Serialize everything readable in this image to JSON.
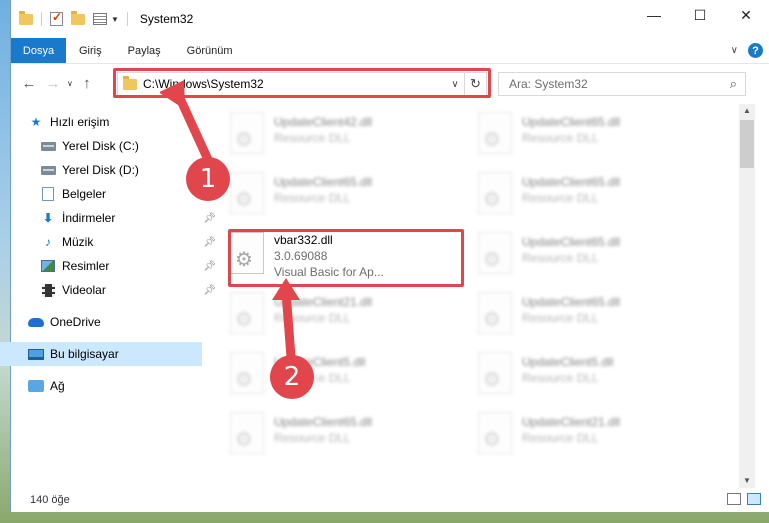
{
  "window": {
    "title": "System32",
    "controls": {
      "minimize": "—",
      "maximize": "☐",
      "close": "✕"
    }
  },
  "ribbon": {
    "tabs": [
      "Dosya",
      "Giriş",
      "Paylaş",
      "Görünüm"
    ],
    "help": "?",
    "expand": "∨"
  },
  "address": {
    "path": "C:\\Windows\\System32",
    "search_placeholder": "Ara: System32"
  },
  "nav_glyphs": {
    "back": "←",
    "forward": "→",
    "up": "↑",
    "refresh": "↻",
    "dropdown": "∨",
    "search": "⌕"
  },
  "sidebar": {
    "quick_access": "Hızlı erişim",
    "items": [
      {
        "label": "Yerel Disk (C:)",
        "icon": "drive-icon",
        "pinned": false
      },
      {
        "label": "Yerel Disk (D:)",
        "icon": "drive-icon",
        "pinned": false
      },
      {
        "label": "Belgeler",
        "icon": "documents-icon",
        "pinned": true
      },
      {
        "label": "İndirmeler",
        "icon": "downloads-icon",
        "pinned": true
      },
      {
        "label": "Müzik",
        "icon": "music-icon",
        "pinned": true
      },
      {
        "label": "Resimler",
        "icon": "pictures-icon",
        "pinned": true
      },
      {
        "label": "Videolar",
        "icon": "videos-icon",
        "pinned": true
      }
    ],
    "onedrive": "OneDrive",
    "this_pc": "Bu bilgisayar",
    "network": "Ağ"
  },
  "files": {
    "left": [
      {
        "name": "UpdateClient42.dll",
        "desc": "Resource DLL"
      },
      {
        "name": "UpdateClient65.dll",
        "desc": "Resource DLL"
      },
      {
        "name": "vbar332.dll",
        "version": "3.0.69088",
        "desc": "Visual Basic for Ap..."
      },
      {
        "name": "UpdateClient21.dll",
        "desc": "Resource DLL"
      },
      {
        "name": "UpdateClient5.dll",
        "desc": "Resource DLL"
      },
      {
        "name": "UpdateClient65.dll",
        "desc": "Resource DLL"
      }
    ],
    "right": [
      {
        "name": "UpdateClient65.dll",
        "desc": "Resource DLL"
      },
      {
        "name": "UpdateClient65.dll",
        "desc": "Resource DLL"
      },
      {
        "name": "UpdateClient65.dll",
        "desc": "Resource DLL"
      },
      {
        "name": "UpdateClient65.dll",
        "desc": "Resource DLL"
      },
      {
        "name": "UpdateClient5.dll",
        "desc": "Resource DLL"
      },
      {
        "name": "UpdateClient21.dll",
        "desc": "Resource DLL"
      }
    ]
  },
  "status": {
    "count": "140 öğe"
  },
  "callouts": {
    "one": "1",
    "two": "2"
  },
  "colors": {
    "accent": "#1979ca",
    "highlight": "#e0464c",
    "selected": "#cce8ff"
  }
}
